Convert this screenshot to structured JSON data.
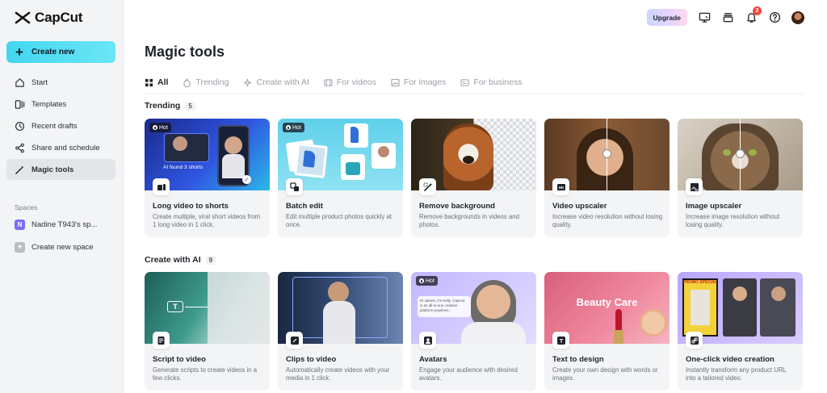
{
  "brand": {
    "name": "CapCut"
  },
  "sidebar": {
    "create_label": "Create new",
    "items": [
      {
        "label": "Start",
        "icon": "home-icon",
        "active": false
      },
      {
        "label": "Templates",
        "icon": "templates-icon",
        "active": false
      },
      {
        "label": "Recent drafts",
        "icon": "clock-icon",
        "active": false
      },
      {
        "label": "Share and schedule",
        "icon": "share-icon",
        "active": false
      },
      {
        "label": "Magic tools",
        "icon": "magic-wand-icon",
        "active": true
      }
    ],
    "spaces_label": "Spaces",
    "spaces": [
      {
        "badge": "N",
        "label": "Nadine T943's sp..."
      },
      {
        "badge": "+",
        "label": "Create new space"
      }
    ]
  },
  "topbar": {
    "upgrade_label": "Upgrade",
    "notification_count": "2",
    "icons": [
      "monitor-icon",
      "stack-icon",
      "bell-icon",
      "help-icon",
      "avatar"
    ]
  },
  "main": {
    "title": "Magic tools",
    "tabs": [
      {
        "label": "All",
        "icon": "grid-icon",
        "active": true
      },
      {
        "label": "Trending",
        "icon": "flame-icon",
        "active": false
      },
      {
        "label": "Create with AI",
        "icon": "sparkle-icon",
        "active": false
      },
      {
        "label": "For videos",
        "icon": "film-icon",
        "active": false
      },
      {
        "label": "For images",
        "icon": "image-icon",
        "active": false
      },
      {
        "label": "For business",
        "icon": "store-icon",
        "active": false
      }
    ],
    "sections": [
      {
        "title": "Trending",
        "count": "5",
        "cards": [
          {
            "title": "Long video to shorts",
            "desc": "Create multiple, viral short videos from 1 long video in 1 click.",
            "hot": "Hot",
            "thumb_text": "AI found 3 shorts"
          },
          {
            "title": "Batch edit",
            "desc": "Edit multiple product photos quickly at once.",
            "hot": "Hot"
          },
          {
            "title": "Remove background",
            "desc": "Remove backgrounds in videos and photos."
          },
          {
            "title": "Video upscaler",
            "desc": "Increase video resolution without losing quality."
          },
          {
            "title": "Image upscaler",
            "desc": "Increase image resolution without losing quality."
          }
        ]
      },
      {
        "title": "Create with AI",
        "count": "9",
        "cards": [
          {
            "title": "Script to video",
            "desc": "Generate scripts to create videos in a few clicks."
          },
          {
            "title": "Clips to video",
            "desc": "Automatically create videos with your media in 1 click."
          },
          {
            "title": "Avatars",
            "desc": "Engage your audience with desired avatars.",
            "hot": "Hot",
            "thumb_text": "Hi James, I'm Kelly. CapCut is an all-in-one creative platform powered..."
          },
          {
            "title": "Text to design",
            "desc": "Create your own design with words or images.",
            "thumb_text": "Beauty Care"
          },
          {
            "title": "One-click video creation",
            "desc": "Instantly transform any product URL into a tailored video.",
            "thumb_text": "PROMO SPECIAL"
          }
        ]
      }
    ]
  }
}
